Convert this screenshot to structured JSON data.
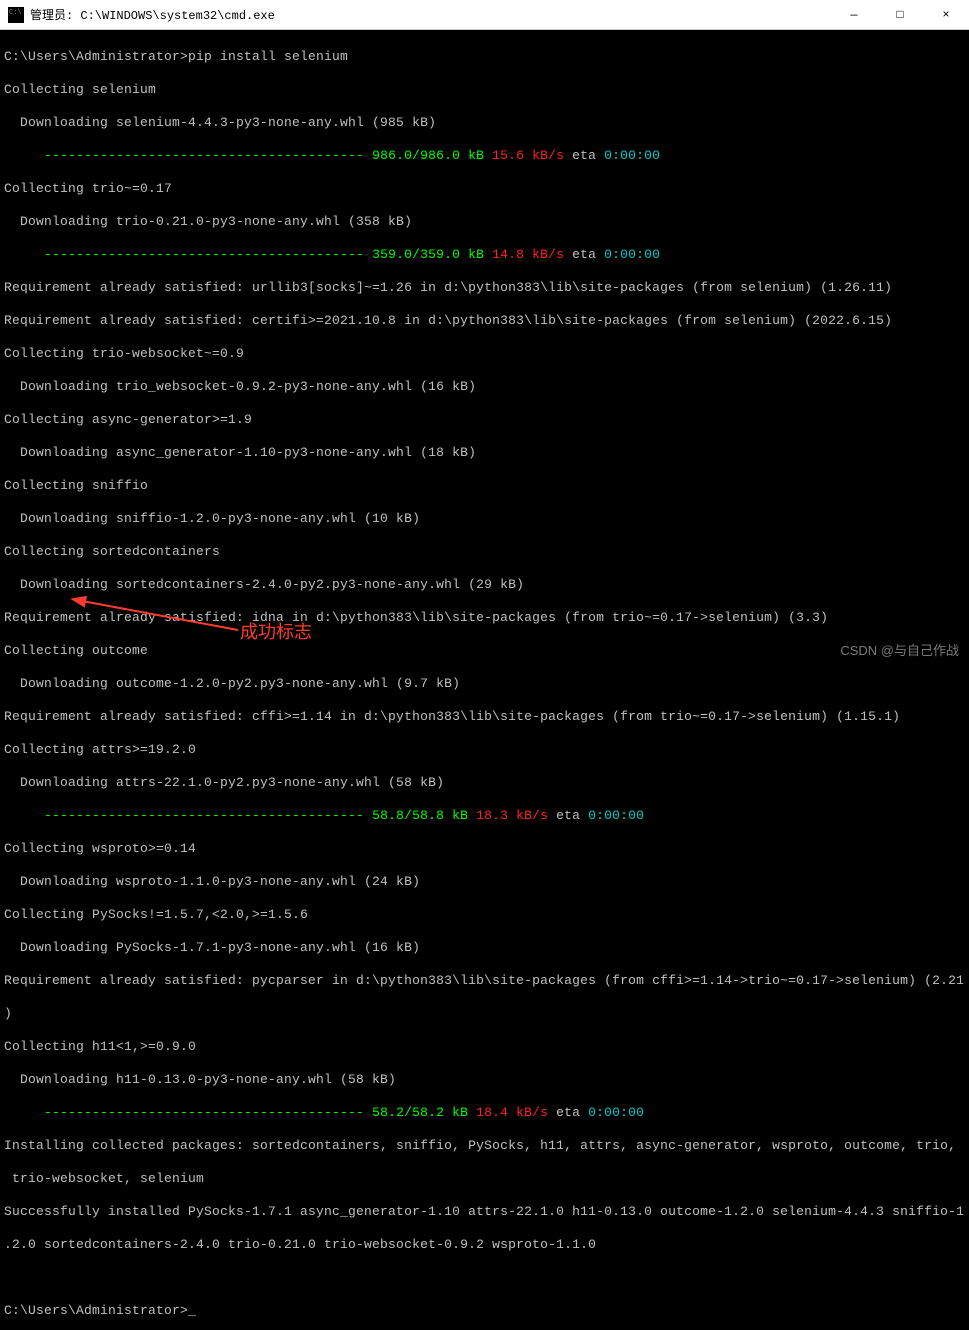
{
  "window": {
    "title": "管理员: C:\\WINDOWS\\system32\\cmd.exe",
    "minimize": "—",
    "maximize": "□",
    "close": "×"
  },
  "prompt1": "C:\\Users\\Administrator>",
  "command": "pip install selenium",
  "lines": {
    "l1": "Collecting selenium",
    "l2": "  Downloading selenium-4.4.3-py3-none-any.whl (985 kB)",
    "dash1": "     ---------------------------------------- ",
    "prog1a": "986.0/986.0 kB ",
    "prog1b": "15.6 kB/s ",
    "prog1c": "eta ",
    "prog1d": "0:00:00",
    "l3": "Collecting trio~=0.17",
    "l4": "  Downloading trio-0.21.0-py3-none-any.whl (358 kB)",
    "dash2": "     ---------------------------------------- ",
    "prog2a": "359.0/359.0 kB ",
    "prog2b": "14.8 kB/s ",
    "prog2c": "eta ",
    "prog2d": "0:00:00",
    "l5": "Requirement already satisfied: urllib3[socks]~=1.26 in d:\\python383\\lib\\site-packages (from selenium) (1.26.11)",
    "l6": "Requirement already satisfied: certifi>=2021.10.8 in d:\\python383\\lib\\site-packages (from selenium) (2022.6.15)",
    "l7": "Collecting trio-websocket~=0.9",
    "l8": "  Downloading trio_websocket-0.9.2-py3-none-any.whl (16 kB)",
    "l9": "Collecting async-generator>=1.9",
    "l10": "  Downloading async_generator-1.10-py3-none-any.whl (18 kB)",
    "l11": "Collecting sniffio",
    "l12": "  Downloading sniffio-1.2.0-py3-none-any.whl (10 kB)",
    "l13": "Collecting sortedcontainers",
    "l14": "  Downloading sortedcontainers-2.4.0-py2.py3-none-any.whl (29 kB)",
    "l15": "Requirement already satisfied: idna in d:\\python383\\lib\\site-packages (from trio~=0.17->selenium) (3.3)",
    "l16": "Collecting outcome",
    "l17": "  Downloading outcome-1.2.0-py2.py3-none-any.whl (9.7 kB)",
    "l18": "Requirement already satisfied: cffi>=1.14 in d:\\python383\\lib\\site-packages (from trio~=0.17->selenium) (1.15.1)",
    "l19": "Collecting attrs>=19.2.0",
    "l20": "  Downloading attrs-22.1.0-py2.py3-none-any.whl (58 kB)",
    "dash3": "     ---------------------------------------- ",
    "prog3a": "58.8/58.8 kB ",
    "prog3b": "18.3 kB/s ",
    "prog3c": "eta ",
    "prog3d": "0:00:00",
    "l21": "Collecting wsproto>=0.14",
    "l22": "  Downloading wsproto-1.1.0-py3-none-any.whl (24 kB)",
    "l23": "Collecting PySocks!=1.5.7,<2.0,>=1.5.6",
    "l24": "  Downloading PySocks-1.7.1-py3-none-any.whl (16 kB)",
    "l25": "Requirement already satisfied: pycparser in d:\\python383\\lib\\site-packages (from cffi>=1.14->trio~=0.17->selenium) (2.21",
    "l25b": ")",
    "l26": "Collecting h11<1,>=0.9.0",
    "l27": "  Downloading h11-0.13.0-py3-none-any.whl (58 kB)",
    "dash4": "     ---------------------------------------- ",
    "prog4a": "58.2/58.2 kB ",
    "prog4b": "18.4 kB/s ",
    "prog4c": "eta ",
    "prog4d": "0:00:00",
    "l28": "Installing collected packages: sortedcontainers, sniffio, PySocks, h11, attrs, async-generator, wsproto, outcome, trio,",
    "l28b": " trio-websocket, selenium",
    "l29": "Successfully installed PySocks-1.7.1 async_generator-1.10 attrs-22.1.0 h11-0.13.0 outcome-1.2.0 selenium-4.4.3 sniffio-1",
    "l29b": ".2.0 sortedcontainers-2.4.0 trio-0.21.0 trio-websocket-0.9.2 wsproto-1.1.0"
  },
  "prompt2": "C:\\Users\\Administrator>",
  "cursor": "_",
  "annotation": "成功标志",
  "watermark": "CSDN @与自己作战"
}
